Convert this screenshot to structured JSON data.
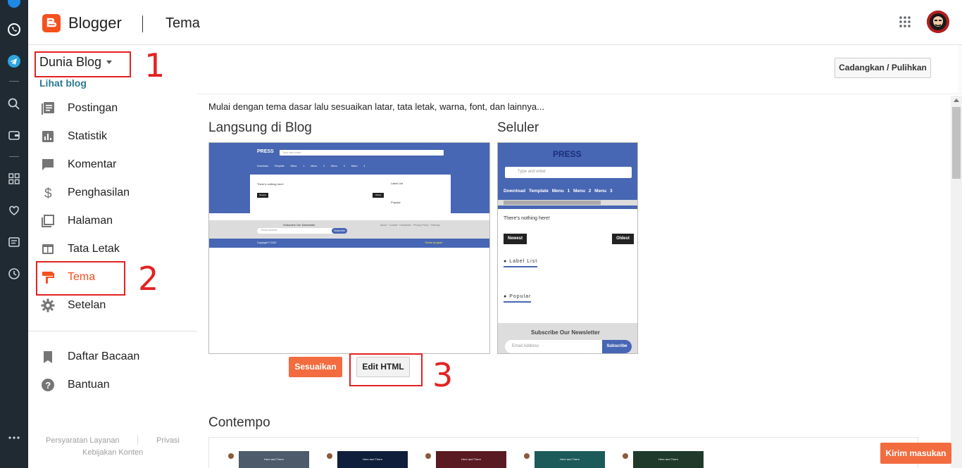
{
  "header": {
    "brand": "Blogger",
    "page_title": "Tema"
  },
  "sidebar": {
    "blog_name": "Dunia Blog",
    "view_blog": "Lihat blog",
    "items": [
      {
        "label": "Postingan",
        "icon": "posts-icon"
      },
      {
        "label": "Statistik",
        "icon": "stats-icon"
      },
      {
        "label": "Komentar",
        "icon": "comments-icon"
      },
      {
        "label": "Penghasilan",
        "icon": "earnings-icon"
      },
      {
        "label": "Halaman",
        "icon": "pages-icon"
      },
      {
        "label": "Tata Letak",
        "icon": "layout-icon"
      },
      {
        "label": "Tema",
        "icon": "theme-icon",
        "active": true
      },
      {
        "label": "Setelan",
        "icon": "settings-icon"
      }
    ],
    "secondary": [
      {
        "label": "Daftar Bacaan",
        "icon": "bookmark-icon"
      },
      {
        "label": "Bantuan",
        "icon": "help-icon"
      }
    ],
    "footer": {
      "terms": "Persyaratan Layanan",
      "privacy": "Privasi",
      "content_policy": "Kebijakan Konten"
    }
  },
  "annotations": [
    "1",
    "2",
    "3"
  ],
  "main": {
    "backup_button": "Cadangkan / Pulihkan",
    "intro": "Mulai dengan tema dasar lalu sesuaikan latar, tata letak, warna, font, dan lainnya...",
    "live_title": "Langsung di Blog",
    "mobile_title": "Seluler",
    "customize_button": "Sesuaikan",
    "edit_html_button": "Edit HTML",
    "contempo_title": "Contempo",
    "desktop_preview": {
      "logo": "PRESS",
      "search_placeholder": "Type and enter",
      "nav": [
        "Download Template",
        "Menu 1",
        "Menu 2",
        "Menu 3",
        "Menu 4"
      ],
      "empty": "There's nothing here!",
      "newest": "Newest",
      "oldest": "Oldest",
      "label_list": "Label List",
      "popular": "Popular",
      "newsletter": "Subscribe Our Newsletter",
      "email_placeholder": "Email Address",
      "subscribe": "Subscribe",
      "footer_links": "About · Contact · Disclaimer · Privacy Policy · Sitemap",
      "copyright": "Copyright © 2020",
      "credit": "Theme by Igniel"
    },
    "mobile_preview": {
      "logo": "PRESS",
      "search_placeholder": "Type and enter",
      "nav": [
        "Download Template",
        "Menu 1",
        "Menu 2",
        "Menu 3"
      ],
      "empty": "There's nothing here!",
      "newest": "Newest",
      "oldest": "Oldest",
      "label_list": "Label List",
      "popular": "Popular",
      "newsletter": "Subscribe Our Newsletter",
      "email_placeholder": "Email Address",
      "subscribe": "Subscribe"
    },
    "gallery_thumbs": [
      {
        "caption": "Here and There",
        "bg": "#4d5b6b"
      },
      {
        "caption": "Here and There",
        "bg": "#0f1e3a"
      },
      {
        "caption": "Here and There",
        "bg": "#5a1a22"
      },
      {
        "caption": "Here and There",
        "bg": "#1d5a5a"
      },
      {
        "caption": "Here and There",
        "bg": "#1f3a2b"
      }
    ]
  },
  "feedback_button": "Kirim masukan",
  "colors": {
    "accent": "#f4511e",
    "link": "#2a7a8f",
    "annotation": "#e32222",
    "preview_blue": "#4766b3"
  }
}
